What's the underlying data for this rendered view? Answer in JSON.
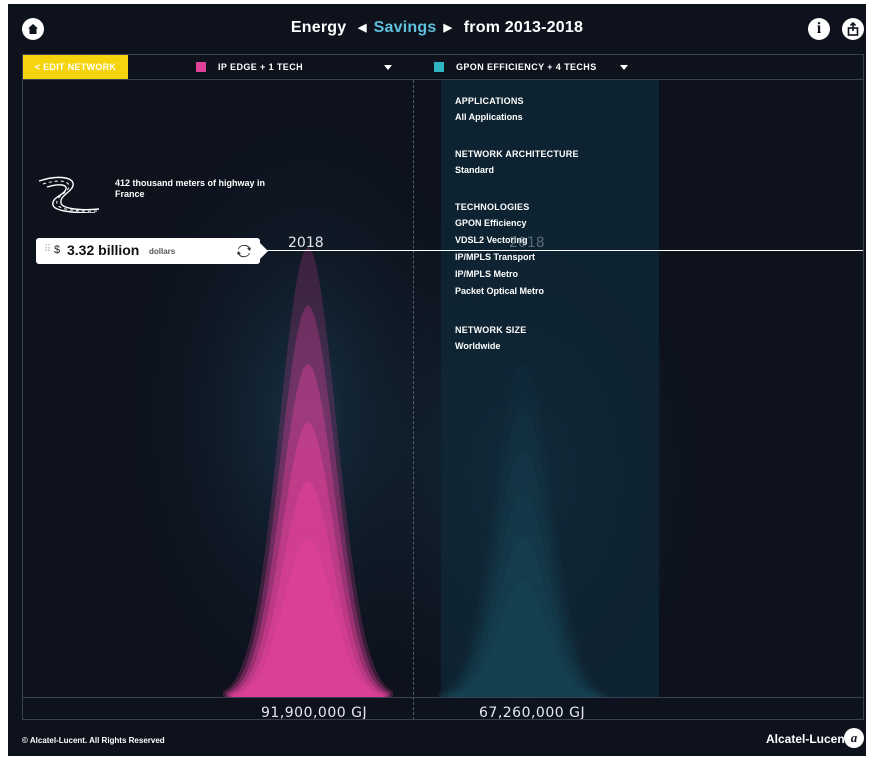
{
  "header": {
    "title_prefix": "Energy",
    "title_mode": "Savings",
    "title_suffix": "from 2013-2018"
  },
  "toolbar": {
    "edit_network_label": "< EDIT NETWORK",
    "network_a": {
      "label": "IP EDGE + 1 TECH",
      "color": "#e0429a"
    },
    "network_b": {
      "label": "GPON EFFICIENCY + 4 TECHS",
      "color": "#2fb4c4"
    }
  },
  "overlay": {
    "applications": {
      "heading": "APPLICATIONS",
      "items": [
        "All Applications"
      ]
    },
    "architecture": {
      "heading": "NETWORK ARCHITECTURE",
      "items": [
        "Standard"
      ]
    },
    "technologies": {
      "heading": "TECHNOLOGIES",
      "items": [
        "GPON Efficiency",
        "VDSL2 Vectoring",
        "IP/MPLS Transport",
        "IP/MPLS Metro",
        "Packet Optical Metro"
      ]
    },
    "network_size": {
      "heading": "NETWORK SIZE",
      "items": [
        "Worldwide"
      ]
    }
  },
  "equivalence": {
    "text": "412 thousand meters of highway in France",
    "icon": "highway-road-icon"
  },
  "value_marker": {
    "currency": "$",
    "amount": "3.32 billion",
    "unit": "dollars"
  },
  "years": {
    "a": "2018",
    "b": "2018"
  },
  "totals": {
    "a": "91,900,000 GJ",
    "b": "67,260,000 GJ"
  },
  "chart_data": {
    "type": "area",
    "series": [
      {
        "name": "IP EDGE + 1 TECH",
        "color": "#e0429a",
        "total_label": "91,900,000 GJ",
        "peak_fraction": 1.0,
        "layers": 6
      },
      {
        "name": "GPON EFFICIENCY + 4 TECHS",
        "color": "#2fb4c4",
        "total_label": "67,260,000 GJ",
        "peak_fraction": 0.74,
        "layers": 6
      }
    ]
  },
  "footer": {
    "copyright": "© Alcatel-Lucent. All Rights Reserved",
    "brand": "Alcatel-Lucent"
  }
}
